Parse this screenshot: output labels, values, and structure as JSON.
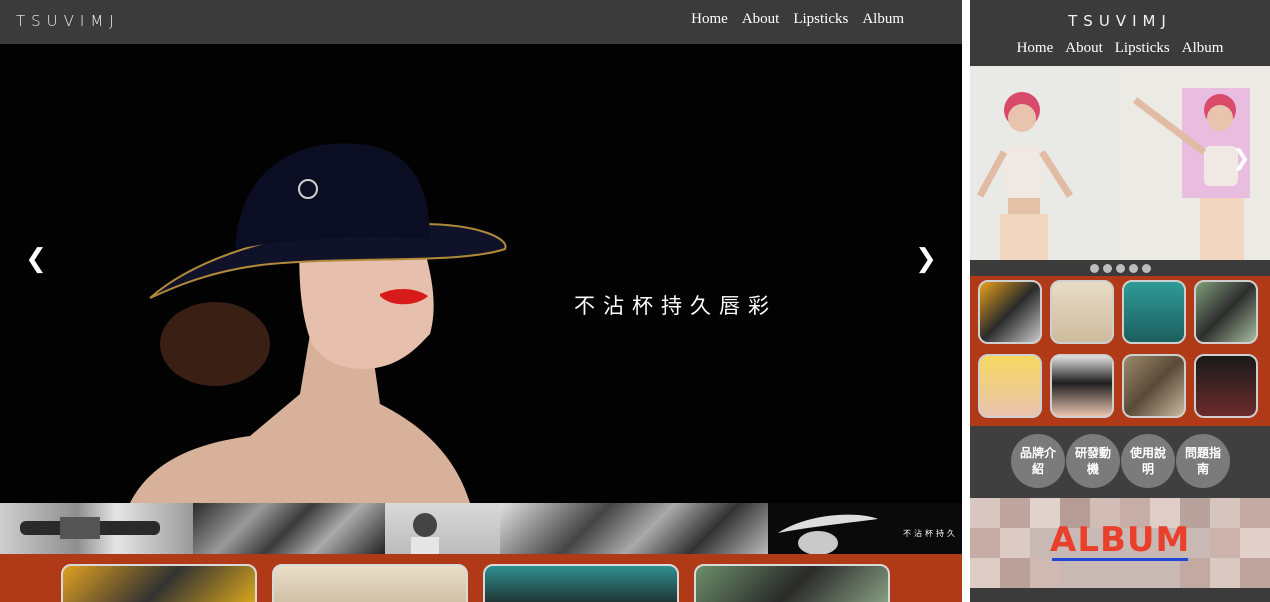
{
  "brand": {
    "logo_text": "TSUVIMJ"
  },
  "desktop": {
    "nav": [
      {
        "label": "Home"
      },
      {
        "label": "About"
      },
      {
        "label": "Lipsticks"
      },
      {
        "label": "Album"
      }
    ],
    "hero": {
      "tagline": "不沾杯持久唇彩",
      "prev_icon": "chevron-left-icon",
      "next_icon": "chevron-right-icon"
    },
    "strip": {
      "tagline_small": "不沾杯持久"
    }
  },
  "mobile": {
    "nav": [
      {
        "label": "Home"
      },
      {
        "label": "About"
      },
      {
        "label": "Lipsticks"
      },
      {
        "label": "Album"
      }
    ],
    "dots_count": 5,
    "circles": [
      {
        "label": "品牌介紹"
      },
      {
        "label": "研發動機"
      },
      {
        "label": "使用說明"
      },
      {
        "label": "問題指南"
      }
    ],
    "album_title": "ALBUM"
  },
  "colors": {
    "header_bg": "#3b3b3b",
    "accent_red": "#b03a17",
    "album_red": "#e8402a",
    "album_underline": "#2346d6"
  }
}
